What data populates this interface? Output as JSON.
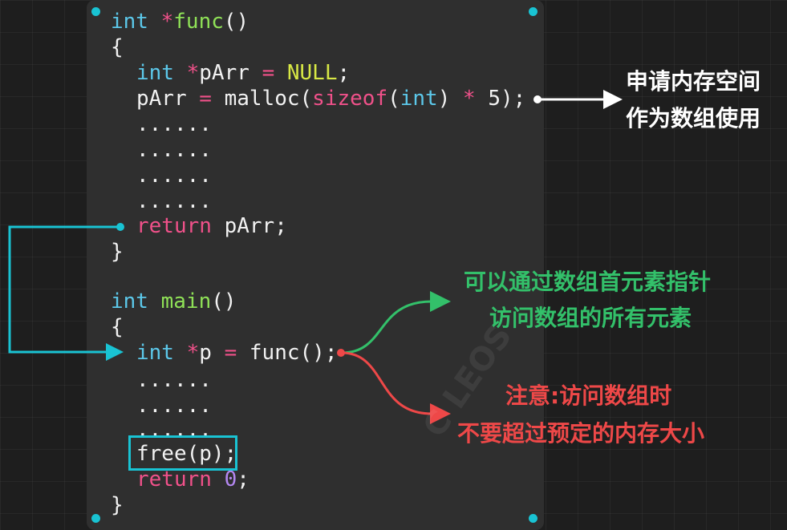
{
  "colors": {
    "background": "#1e1e1e",
    "panel": "#2f2f2f",
    "cyan": "#19c3d3",
    "white_arrow": "#ffffff",
    "green": "#33c06a",
    "red": "#ee4848",
    "type": "#5cc8ea",
    "operator": "#f0518a",
    "function": "#8fe157",
    "null": "#d8e845",
    "number": "#b488f2"
  },
  "code": {
    "l1": {
      "t1": "int",
      "t2": " *",
      "t3": "func",
      "t4": "()"
    },
    "l2": {
      "t1": "{"
    },
    "l3": {
      "t1": "int",
      "t2": " *",
      "t3": "pArr ",
      "t4": "=",
      "t5": " NULL",
      "t6": ";"
    },
    "l4": {
      "t1": "pArr ",
      "t2": "=",
      "t3": " malloc(",
      "t4": "sizeof",
      "t5": "(",
      "t6": "int",
      "t7": ") ",
      "t8": "*",
      "t9": " 5);"
    },
    "l5": {
      "t1": "......"
    },
    "l6": {
      "t1": "......"
    },
    "l7": {
      "t1": "......"
    },
    "l8": {
      "t1": "......"
    },
    "l9": {
      "t1": "return",
      "t2": " pArr;"
    },
    "l10": {
      "t1": "}"
    },
    "l11": {
      "t1": "int",
      "t2": " main",
      "t3": "()"
    },
    "l12": {
      "t1": "{"
    },
    "l13": {
      "t1": "int",
      "t2": " *",
      "t3": "p ",
      "t4": "=",
      "t5": " func();"
    },
    "l14": {
      "t1": "......"
    },
    "l15": {
      "t1": "......"
    },
    "l16": {
      "t1": "......"
    },
    "l17": {
      "t1": "free(p);"
    },
    "l18": {
      "t1": "return",
      "t2": " 0",
      "t3": ";"
    },
    "l19": {
      "t1": "}"
    }
  },
  "annotations": {
    "malloc_note": [
      "申请内存空间",
      "作为数组使用"
    ],
    "access_note": [
      "可以通过数组首元素指针",
      "访问数组的所有元素"
    ],
    "warning_note": [
      "注意:访问数组时",
      "不要超过预定的内存大小"
    ]
  },
  "watermark": "C LEOS"
}
